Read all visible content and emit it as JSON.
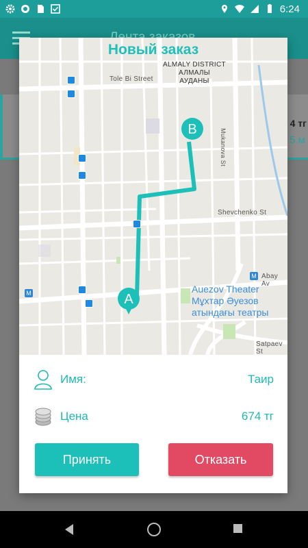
{
  "status_bar": {
    "time": "6:24",
    "left_icons": [
      "gear-icon",
      "circle-icon",
      "sd-card-icon",
      "checkbox-icon"
    ],
    "right_icons": [
      "location-icon",
      "wifi-icon",
      "signal-icon",
      "battery-icon"
    ]
  },
  "background_app": {
    "title": "Лента заказов",
    "card_price": "4 тг",
    "card_distance": "5 м"
  },
  "dialog": {
    "title": "Новый заказ",
    "map": {
      "district": "ALMALY DISTRICT\nАЛМАЛЫ\nАУДАНЫ",
      "street_tole_bi": "Tole Bi Street",
      "street_shevchenko": "Shevchenko St",
      "street_mukanova": "Mukanova St",
      "street_abay": "Abay Av",
      "street_satpaev": "Satpaev St",
      "poi_name": "Auezov Theater\nМұхтар Әуезов\nатындағы театры",
      "marker_start": "A",
      "marker_end": "B",
      "route_color": "#1dbfb9"
    },
    "name_label": "Имя:",
    "name_value": "Таир",
    "price_label": "Цена",
    "price_value": "674 тг",
    "accept_label": "Принять",
    "reject_label": "Отказать"
  },
  "colors": {
    "accent": "#1dbfb9",
    "reject": "#e24a63",
    "status_bar": "#1e9e9a"
  }
}
